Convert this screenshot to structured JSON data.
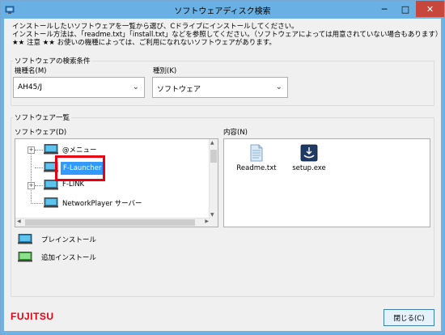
{
  "window": {
    "title": "ソフトウェアディスク検索",
    "minimize": "─",
    "maximize": "□",
    "close": "✕"
  },
  "intro": {
    "line1": "インストールしたいソフトウェアを一覧から選び、Cドライブにインストールしてください。",
    "line2": "インストール方法は、「readme.txt」「install.txt」などを参照してください。（ソフトウェアによっては用意されていない場合もあります）",
    "line3": "★★ 注意 ★★ お使いの機種によっては、ご利用になれないソフトウェアがあります。"
  },
  "search_conditions": {
    "group_label": "ソフトウェアの検索条件",
    "model_label": "機種名(M)",
    "model_value": "AH45/J",
    "type_label": "種別(K)",
    "type_value": "ソフトウェア"
  },
  "software_list": {
    "group_label": "ソフトウェア一覧",
    "software_label": "ソフトウェア(D)",
    "contents_label": "内容(N)",
    "items": [
      {
        "label": "@メニュー",
        "expandable": true
      },
      {
        "label": "F-Launcher",
        "expandable": false,
        "selected": true
      },
      {
        "label": "F-LINK",
        "expandable": true
      },
      {
        "label": "NetworkPlayer サーバー",
        "expandable": false
      }
    ],
    "files": [
      {
        "name": "Readme.txt",
        "icon": "text-file-icon"
      },
      {
        "name": "setup.exe",
        "icon": "installer-icon"
      }
    ]
  },
  "legend": {
    "preinstall": "プレインストール",
    "additional": "追加インストール"
  },
  "footer": {
    "logo": "FUJITSU",
    "close_button": "閉じる(C)"
  },
  "colors": {
    "title_bar": "#69b1e4",
    "close_button": "#c7473c",
    "selection": "#3399ff",
    "highlight_box": "#e60012",
    "logo": "#e60012"
  }
}
